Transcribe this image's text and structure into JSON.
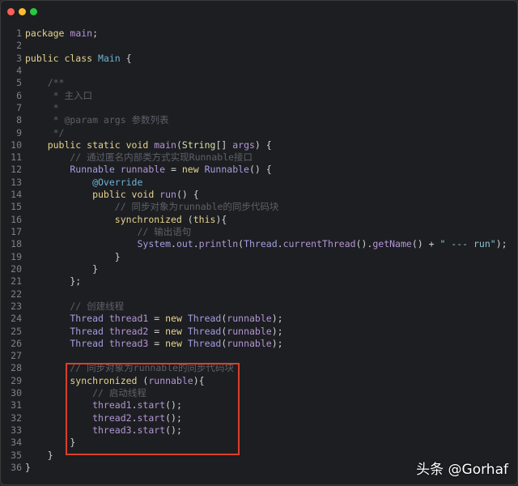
{
  "window": {
    "controls": [
      {
        "name": "close",
        "color": "#fe5f57"
      },
      {
        "name": "minimize",
        "color": "#febc2e"
      },
      {
        "name": "maximize",
        "color": "#28c840"
      }
    ]
  },
  "watermark": "头条 @Gorhaf",
  "highlight_color": "#d9402c",
  "lines": [
    [
      [
        "k",
        "package "
      ],
      [
        "v",
        "main"
      ],
      [
        "p",
        ";"
      ]
    ],
    [],
    [
      [
        "k",
        "public class "
      ],
      [
        "m",
        "Main"
      ],
      [
        "p",
        " {"
      ]
    ],
    [],
    [
      [
        "c",
        "    /**"
      ]
    ],
    [
      [
        "c",
        "     * 主入口"
      ]
    ],
    [
      [
        "c",
        "     *"
      ]
    ],
    [
      [
        "c",
        "     * @param args 参数列表"
      ]
    ],
    [
      [
        "c",
        "     */"
      ]
    ],
    [
      [
        "k",
        "    public static void "
      ],
      [
        "v",
        "main"
      ],
      [
        "p",
        "("
      ],
      [
        "g",
        "String"
      ],
      [
        "p",
        "[] "
      ],
      [
        "v",
        "args"
      ],
      [
        "p",
        ") {"
      ]
    ],
    [
      [
        "c",
        "        // 通过匿名内部类方式实现Runnable接口"
      ]
    ],
    [
      [
        "t",
        "        Runnable "
      ],
      [
        "v",
        "runnable"
      ],
      [
        "p",
        " = "
      ],
      [
        "k",
        "new "
      ],
      [
        "t",
        "Runnable"
      ],
      [
        "p",
        "() {"
      ]
    ],
    [
      [
        "a",
        "            @Override"
      ]
    ],
    [
      [
        "k",
        "            public void "
      ],
      [
        "v",
        "run"
      ],
      [
        "p",
        "() {"
      ]
    ],
    [
      [
        "c",
        "                // 同步对象为runnable的同步代码块"
      ]
    ],
    [
      [
        "k",
        "                synchronized "
      ],
      [
        "p",
        "("
      ],
      [
        "k",
        "this"
      ],
      [
        "p",
        "){"
      ]
    ],
    [
      [
        "c",
        "                    // 输出语句"
      ]
    ],
    [
      [
        "t",
        "                    System"
      ],
      [
        "p",
        "."
      ],
      [
        "t",
        "out"
      ],
      [
        "p",
        "."
      ],
      [
        "v",
        "println"
      ],
      [
        "p",
        "("
      ],
      [
        "t",
        "Thread"
      ],
      [
        "p",
        "."
      ],
      [
        "v",
        "currentThread"
      ],
      [
        "p",
        "()."
      ],
      [
        "v",
        "getName"
      ],
      [
        "p",
        "() + "
      ],
      [
        "s",
        "\" --- run\""
      ],
      [
        "p",
        ");"
      ]
    ],
    [
      [
        "p",
        "                }"
      ]
    ],
    [
      [
        "p",
        "            }"
      ]
    ],
    [
      [
        "p",
        "        };"
      ]
    ],
    [],
    [
      [
        "c",
        "        // 创建线程"
      ]
    ],
    [
      [
        "t",
        "        Thread "
      ],
      [
        "v",
        "thread1"
      ],
      [
        "p",
        " = "
      ],
      [
        "k",
        "new "
      ],
      [
        "t",
        "Thread"
      ],
      [
        "p",
        "("
      ],
      [
        "v",
        "runnable"
      ],
      [
        "p",
        ");"
      ]
    ],
    [
      [
        "t",
        "        Thread "
      ],
      [
        "v",
        "thread2"
      ],
      [
        "p",
        " = "
      ],
      [
        "k",
        "new "
      ],
      [
        "t",
        "Thread"
      ],
      [
        "p",
        "("
      ],
      [
        "v",
        "runnable"
      ],
      [
        "p",
        ");"
      ]
    ],
    [
      [
        "t",
        "        Thread "
      ],
      [
        "v",
        "thread3"
      ],
      [
        "p",
        " = "
      ],
      [
        "k",
        "new "
      ],
      [
        "t",
        "Thread"
      ],
      [
        "p",
        "("
      ],
      [
        "v",
        "runnable"
      ],
      [
        "p",
        ");"
      ]
    ],
    [],
    [
      [
        "c",
        "        // 同步对象为runnable的同步代码块"
      ]
    ],
    [
      [
        "k",
        "        synchronized "
      ],
      [
        "p",
        "("
      ],
      [
        "v",
        "runnable"
      ],
      [
        "p",
        "){"
      ]
    ],
    [
      [
        "c",
        "            // 启动线程"
      ]
    ],
    [
      [
        "v",
        "            thread1"
      ],
      [
        "p",
        "."
      ],
      [
        "v",
        "start"
      ],
      [
        "p",
        "();"
      ]
    ],
    [
      [
        "v",
        "            thread2"
      ],
      [
        "p",
        "."
      ],
      [
        "v",
        "start"
      ],
      [
        "p",
        "();"
      ]
    ],
    [
      [
        "v",
        "            thread3"
      ],
      [
        "p",
        "."
      ],
      [
        "v",
        "start"
      ],
      [
        "p",
        "();"
      ]
    ],
    [
      [
        "p",
        "        }"
      ]
    ],
    [
      [
        "p",
        "    }"
      ]
    ],
    [
      [
        "p",
        "}"
      ]
    ]
  ]
}
